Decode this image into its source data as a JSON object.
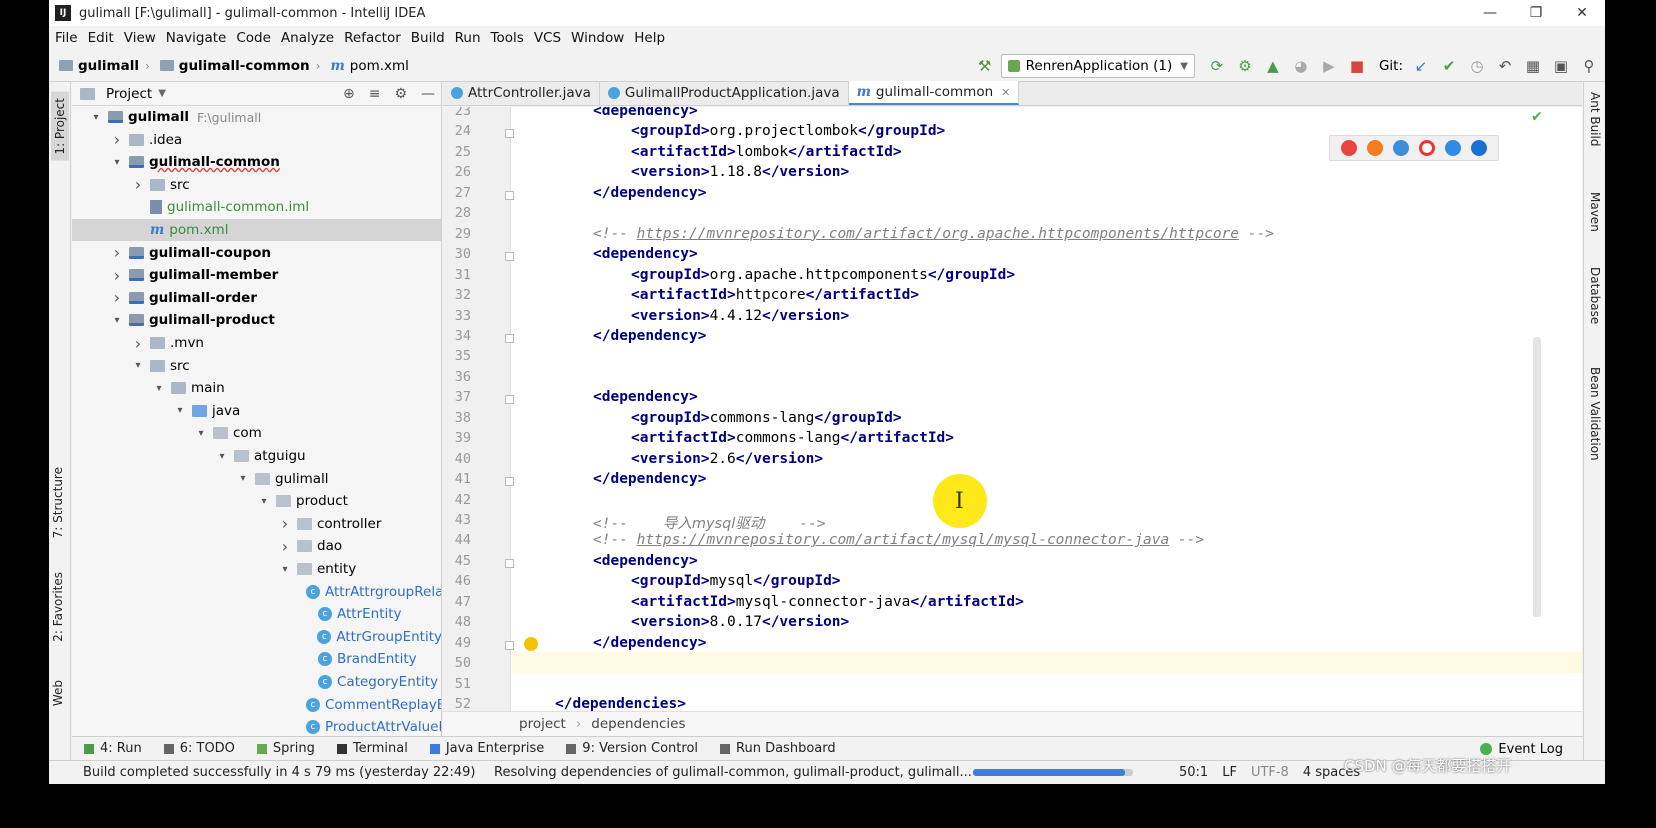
{
  "window": {
    "title": "gulimall [F:\\gulimall] - gulimall-common - IntelliJ IDEA",
    "app_icon": "IJ"
  },
  "menu": [
    "File",
    "Edit",
    "View",
    "Navigate",
    "Code",
    "Analyze",
    "Refactor",
    "Build",
    "Run",
    "Tools",
    "VCS",
    "Window",
    "Help"
  ],
  "breadcrumbs": [
    "gulimall",
    "gulimall-common",
    "pom.xml"
  ],
  "toolbar": {
    "run_config": "RenrenApplication (1)",
    "git_label": "Git:"
  },
  "left_tools": [
    "1: Project",
    "7: Structure",
    "2: Favorites",
    "Web"
  ],
  "right_tools": [
    "Ant Build",
    "Maven",
    "Database",
    "Bean Validation"
  ],
  "project": {
    "header": "Project",
    "tree": [
      {
        "label": "gulimall",
        "extra": "F:\\gulimall",
        "depth": 0,
        "arrow": "down",
        "icon": "module",
        "bold": true
      },
      {
        "label": ".idea",
        "depth": 1,
        "arrow": "right",
        "icon": "folder"
      },
      {
        "label": "gulimall-common",
        "depth": 1,
        "arrow": "down",
        "icon": "module",
        "bold": true
      },
      {
        "label": "src",
        "depth": 2,
        "arrow": "right",
        "icon": "src"
      },
      {
        "label": "gulimall-common.iml",
        "depth": 2,
        "arrow": "",
        "icon": "iml",
        "color": "green"
      },
      {
        "label": "pom.xml",
        "depth": 2,
        "arrow": "",
        "icon": "xml",
        "color": "green",
        "selected": true
      },
      {
        "label": "gulimall-coupon",
        "depth": 1,
        "arrow": "right",
        "icon": "module",
        "bold": true
      },
      {
        "label": "gulimall-member",
        "depth": 1,
        "arrow": "right",
        "icon": "module",
        "bold": true
      },
      {
        "label": "gulimall-order",
        "depth": 1,
        "arrow": "right",
        "icon": "module",
        "bold": true
      },
      {
        "label": "gulimall-product",
        "depth": 1,
        "arrow": "down",
        "icon": "module",
        "bold": true
      },
      {
        "label": ".mvn",
        "depth": 2,
        "arrow": "right",
        "icon": "folder"
      },
      {
        "label": "src",
        "depth": 2,
        "arrow": "down",
        "icon": "src"
      },
      {
        "label": "main",
        "depth": 3,
        "arrow": "down",
        "icon": "folder"
      },
      {
        "label": "java",
        "depth": 4,
        "arrow": "down",
        "icon": "java"
      },
      {
        "label": "com",
        "depth": 5,
        "arrow": "down",
        "icon": "pkg"
      },
      {
        "label": "atguigu",
        "depth": 6,
        "arrow": "down",
        "icon": "pkg"
      },
      {
        "label": "gulimall",
        "depth": 7,
        "arrow": "down",
        "icon": "pkg"
      },
      {
        "label": "product",
        "depth": 8,
        "arrow": "down",
        "icon": "pkg"
      },
      {
        "label": "controller",
        "depth": 9,
        "arrow": "right",
        "icon": "pkg"
      },
      {
        "label": "dao",
        "depth": 9,
        "arrow": "right",
        "icon": "pkg"
      },
      {
        "label": "entity",
        "depth": 9,
        "arrow": "down",
        "icon": "pkg"
      },
      {
        "label": "AttrAttrgroupRela",
        "depth": 10,
        "arrow": "",
        "icon": "class",
        "color": "blue"
      },
      {
        "label": "AttrEntity",
        "depth": 10,
        "arrow": "",
        "icon": "class",
        "color": "blue"
      },
      {
        "label": "AttrGroupEntity",
        "depth": 10,
        "arrow": "",
        "icon": "class",
        "color": "blue"
      },
      {
        "label": "BrandEntity",
        "depth": 10,
        "arrow": "",
        "icon": "class",
        "color": "blue"
      },
      {
        "label": "CategoryEntity",
        "depth": 10,
        "arrow": "",
        "icon": "class",
        "color": "blue"
      },
      {
        "label": "CommentReplayE",
        "depth": 10,
        "arrow": "",
        "icon": "class",
        "color": "blue"
      },
      {
        "label": "ProductAttrValueE",
        "depth": 10,
        "arrow": "",
        "icon": "class",
        "color": "blue"
      }
    ]
  },
  "editor": {
    "tabs": [
      {
        "label": "AttrController.java",
        "active": false
      },
      {
        "label": "GulimallProductApplication.java",
        "active": false
      },
      {
        "label": "gulimall-common",
        "active": true
      }
    ],
    "first_line": 23,
    "lines": [
      {
        "n": 23,
        "indent": 0,
        "tokens": [
          [
            "tag",
            "<dependency>"
          ]
        ]
      },
      {
        "n": 24,
        "indent": 1,
        "tokens": [
          [
            "tag",
            "<groupId>"
          ],
          [
            "txt",
            "org.projectlombok"
          ],
          [
            "tag",
            "</groupId>"
          ]
        ]
      },
      {
        "n": 25,
        "indent": 1,
        "tokens": [
          [
            "tag",
            "<artifactId>"
          ],
          [
            "txt",
            "lombok"
          ],
          [
            "tag",
            "</artifactId>"
          ]
        ]
      },
      {
        "n": 26,
        "indent": 1,
        "tokens": [
          [
            "tag",
            "<version>"
          ],
          [
            "txt",
            "1.18.8"
          ],
          [
            "tag",
            "</version>"
          ]
        ]
      },
      {
        "n": 27,
        "indent": 0,
        "tokens": [
          [
            "tag",
            "</dependency>"
          ]
        ]
      },
      {
        "n": 28,
        "indent": 0,
        "tokens": []
      },
      {
        "n": 29,
        "indent": 0,
        "tokens": [
          [
            "cmt",
            "<!-- "
          ],
          [
            "link",
            "https://mvnrepository.com/artifact/org.apache.httpcomponents/httpcore"
          ],
          [
            "cmt",
            " -->"
          ]
        ]
      },
      {
        "n": 30,
        "indent": 0,
        "tokens": [
          [
            "tag",
            "<dependency>"
          ]
        ]
      },
      {
        "n": 31,
        "indent": 1,
        "tokens": [
          [
            "tag",
            "<groupId>"
          ],
          [
            "txt",
            "org.apache.httpcomponents"
          ],
          [
            "tag",
            "</groupId>"
          ]
        ]
      },
      {
        "n": 32,
        "indent": 1,
        "tokens": [
          [
            "tag",
            "<artifactId>"
          ],
          [
            "txt",
            "httpcore"
          ],
          [
            "tag",
            "</artifactId>"
          ]
        ]
      },
      {
        "n": 33,
        "indent": 1,
        "tokens": [
          [
            "tag",
            "<version>"
          ],
          [
            "txt",
            "4.4.12"
          ],
          [
            "tag",
            "</version>"
          ]
        ]
      },
      {
        "n": 34,
        "indent": 0,
        "tokens": [
          [
            "tag",
            "</dependency>"
          ]
        ]
      },
      {
        "n": 35,
        "indent": 0,
        "tokens": []
      },
      {
        "n": 36,
        "indent": 0,
        "tokens": []
      },
      {
        "n": 37,
        "indent": 0,
        "tokens": [
          [
            "tag",
            "<dependency>"
          ]
        ]
      },
      {
        "n": 38,
        "indent": 1,
        "tokens": [
          [
            "tag",
            "<groupId>"
          ],
          [
            "txt",
            "commons-lang"
          ],
          [
            "tag",
            "</groupId>"
          ]
        ]
      },
      {
        "n": 39,
        "indent": 1,
        "tokens": [
          [
            "tag",
            "<artifactId>"
          ],
          [
            "txt",
            "commons-lang"
          ],
          [
            "tag",
            "</artifactId>"
          ]
        ]
      },
      {
        "n": 40,
        "indent": 1,
        "tokens": [
          [
            "tag",
            "<version>"
          ],
          [
            "txt",
            "2.6"
          ],
          [
            "tag",
            "</version>"
          ]
        ]
      },
      {
        "n": 41,
        "indent": 0,
        "tokens": [
          [
            "tag",
            "</dependency>"
          ]
        ]
      },
      {
        "n": 42,
        "indent": 0,
        "tokens": []
      },
      {
        "n": 43,
        "indent": 0,
        "tokens": [
          [
            "cmt",
            "<!--    "
          ],
          [
            "cn",
            "导入mysql驱动"
          ],
          [
            "cmt",
            "    -->"
          ]
        ]
      },
      {
        "n": 44,
        "indent": 0,
        "tokens": [
          [
            "cmt",
            "<!-- "
          ],
          [
            "link",
            "https://mvnrepository.com/artifact/mysql/mysql-connector-java"
          ],
          [
            "cmt",
            " -->"
          ]
        ]
      },
      {
        "n": 45,
        "indent": 0,
        "tokens": [
          [
            "tag",
            "<dependency>"
          ]
        ]
      },
      {
        "n": 46,
        "indent": 1,
        "tokens": [
          [
            "tag",
            "<groupId>"
          ],
          [
            "txt",
            "mysql"
          ],
          [
            "tag",
            "</groupId>"
          ]
        ]
      },
      {
        "n": 47,
        "indent": 1,
        "tokens": [
          [
            "tag",
            "<artifactId>"
          ],
          [
            "txt",
            "mysql-connector-java"
          ],
          [
            "tag",
            "</artifactId>"
          ]
        ]
      },
      {
        "n": 48,
        "indent": 1,
        "tokens": [
          [
            "tag",
            "<version>"
          ],
          [
            "txt",
            "8.0.17"
          ],
          [
            "tag",
            "</version>"
          ]
        ]
      },
      {
        "n": 49,
        "indent": 0,
        "tokens": [
          [
            "tag",
            "</dependency>"
          ]
        ]
      },
      {
        "n": 50,
        "indent": 0,
        "tokens": []
      },
      {
        "n": 51,
        "indent": 0,
        "tokens": []
      },
      {
        "n": 52,
        "indent": -1,
        "tokens": [
          [
            "tag",
            "</dependencies>"
          ]
        ]
      }
    ],
    "breadcrumb": [
      "project",
      "dependencies"
    ]
  },
  "bottom_tools": [
    "4: Run",
    "6: TODO",
    "Spring",
    "Terminal",
    "Java Enterprise",
    "9: Version Control",
    "Run Dashboard"
  ],
  "event_log": "Event Log",
  "status": {
    "message": "Build completed successfully in 4 s 79 ms (yesterday 22:49)",
    "progress_text": "Resolving dependencies of gulimall-common, gulimall-product, gulimall...",
    "progress": 0.95,
    "position": "50:1",
    "line_sep": "LF",
    "encoding": "UTF-8",
    "indent": "4 spaces"
  },
  "watermark": "CSDN @每天都要搭搭开",
  "colors": {
    "accent": "#4a88c7",
    "tag": "#000080",
    "comment": "#808080",
    "bulb": "#f5c400",
    "cursor_highlight": "#ffe600"
  }
}
